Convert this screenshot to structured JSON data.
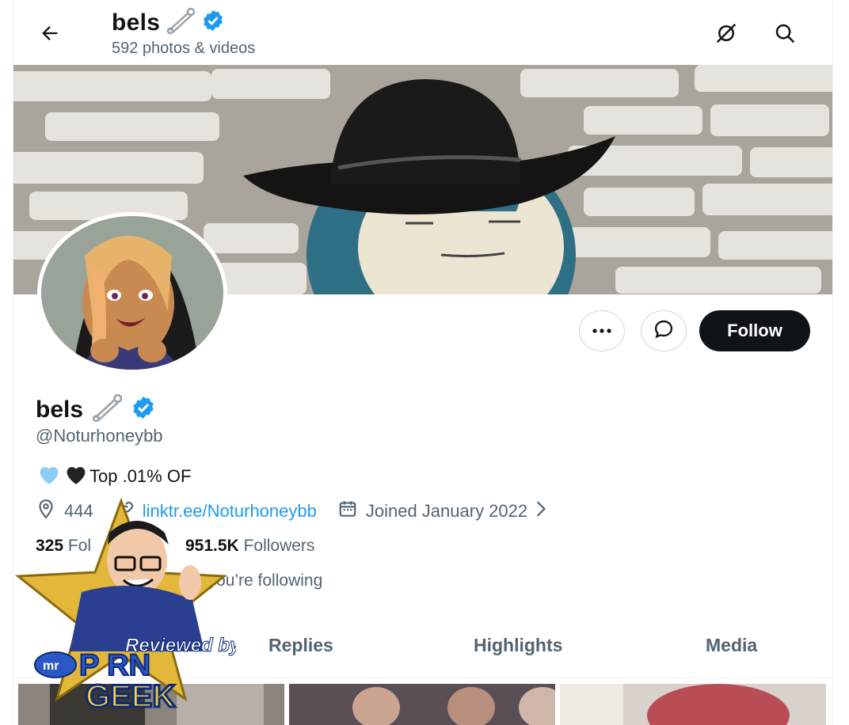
{
  "header": {
    "display_name": "bels",
    "media_count": "592 photos & videos"
  },
  "profile": {
    "display_name": "bels",
    "handle": "@Noturhoneybb",
    "bio_text": "Top .01% OF",
    "location": "444",
    "link": "linktr.ee/Noturhoneybb",
    "joined": "Joined January 2022",
    "following_count": "325",
    "following_label": "Fol",
    "followers_count": "951.5K",
    "followers_label": "Followers",
    "followers_you_follow": "e you’re following"
  },
  "actions": {
    "follow_label": "Follow"
  },
  "tabs": [
    {
      "label": "Replies"
    },
    {
      "label": "Highlights"
    },
    {
      "label": "Media"
    }
  ],
  "overlay_badge": {
    "line1": "Reviewed by",
    "brand_prefix": "mr",
    "brand_word1": "P RN",
    "brand_word2": "GEEK"
  },
  "colors": {
    "accent": "#1d9bf0",
    "follow_bg": "#0f1419",
    "muted_text": "#536471"
  },
  "icons": [
    "back-arrow-icon",
    "safety-pin-icon",
    "verified-badge-icon",
    "hide-icon",
    "search-icon",
    "more-icon",
    "message-icon",
    "location-icon",
    "link-icon",
    "calendar-icon",
    "chevron-right-icon",
    "heart-blue-icon",
    "heart-black-icon"
  ]
}
